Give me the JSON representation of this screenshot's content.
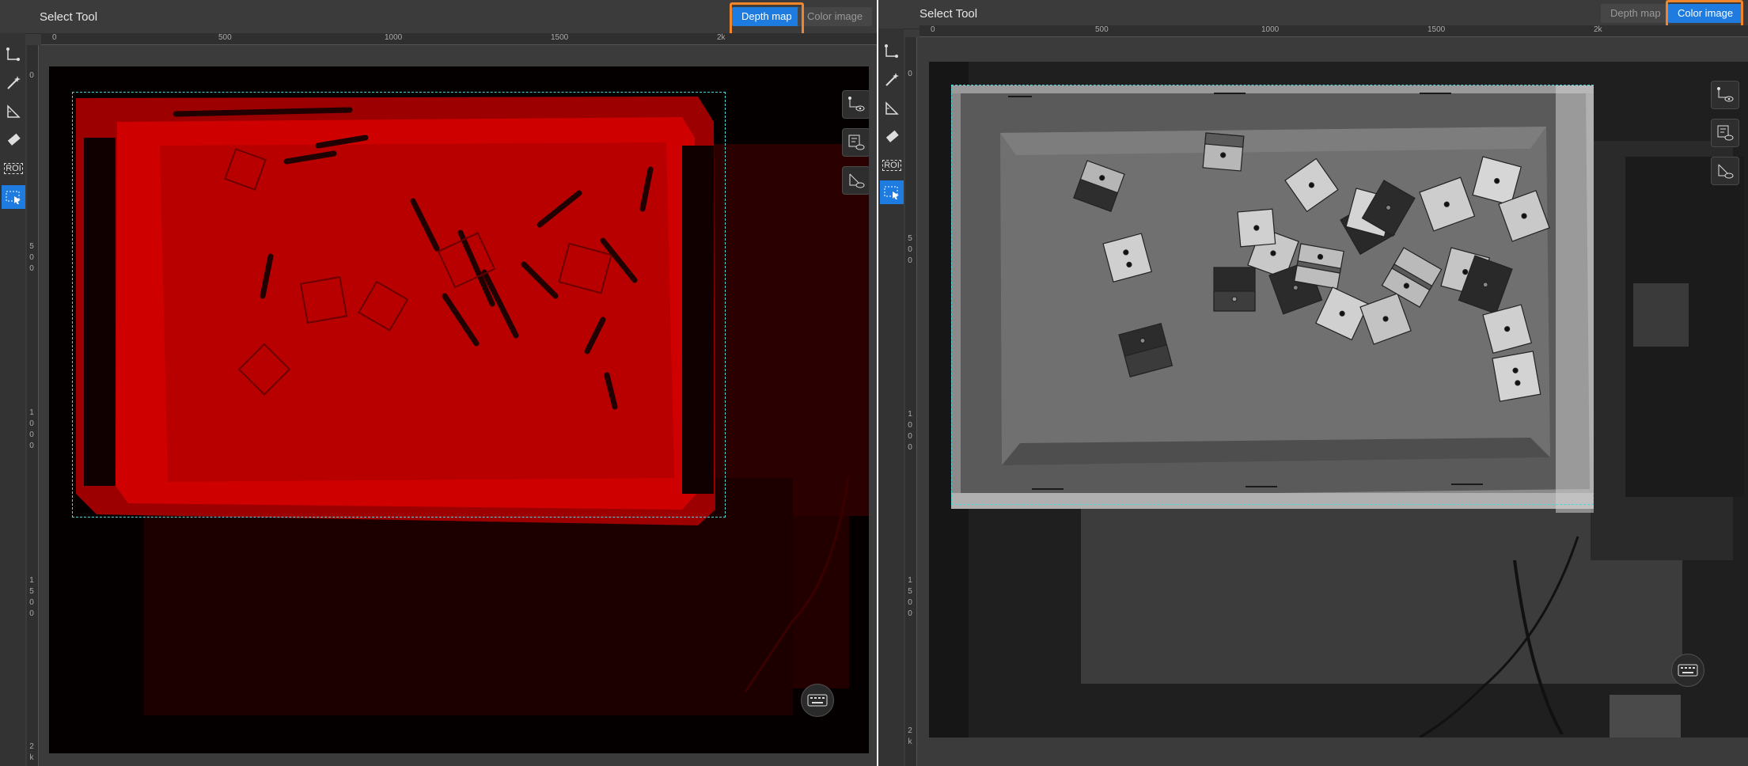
{
  "left_panel": {
    "title": "Select Tool",
    "toggles": {
      "depth_map": "Depth map",
      "color_image": "Color image"
    },
    "active_view": "depth_map",
    "ruler_top_ticks": [
      "0",
      "500",
      "1000",
      "1500",
      "2k"
    ],
    "ruler_left_ticks": [
      "0",
      "500",
      "1000",
      "1500",
      "2k"
    ],
    "tools": [
      "polygon-tool-icon",
      "magic-wand-icon",
      "ruler-tool-icon",
      "eraser-icon",
      "roi-icon",
      "select-tool-icon"
    ],
    "roi_label": "ROI"
  },
  "right_panel": {
    "title": "Select Tool",
    "toggles": {
      "depth_map": "Depth map",
      "color_image": "Color image"
    },
    "active_view": "color_image",
    "ruler_top_ticks": [
      "0",
      "500",
      "1000",
      "1500",
      "2k"
    ],
    "ruler_left_ticks": [
      "0",
      "500",
      "1000",
      "1500",
      "2k"
    ],
    "tools": [
      "polygon-tool-icon",
      "magic-wand-icon",
      "ruler-tool-icon",
      "eraser-icon",
      "roi-icon",
      "select-tool-icon"
    ],
    "roi_label": "ROI"
  },
  "colors": {
    "accent": "#1e7ce0",
    "highlight": "#f0852c",
    "roi": "#4fd6d9",
    "depth_red": "#c40000"
  }
}
